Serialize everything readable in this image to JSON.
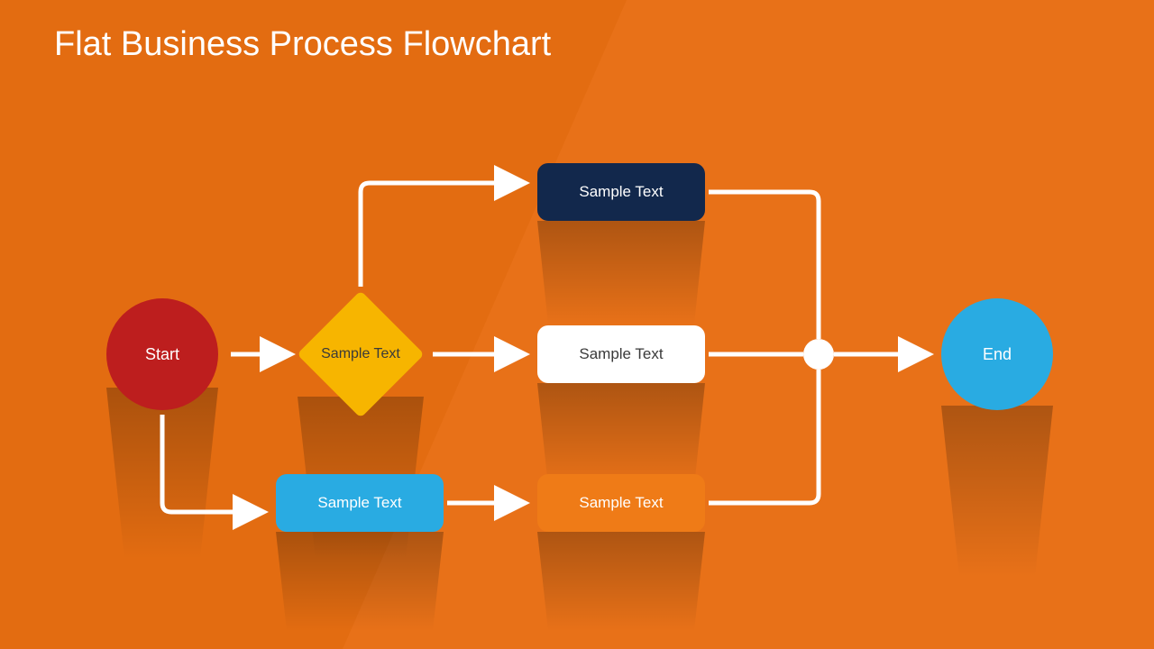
{
  "title": "Flat Business Process Flowchart",
  "nodes": {
    "start": "Start",
    "decision": "Sample Text",
    "top": "Sample Text",
    "mid": "Sample Text",
    "altProc": "Sample Text",
    "bottom": "Sample Text",
    "end": "End"
  },
  "colors": {
    "bg": "#E36C11",
    "start": "#BD1E1E",
    "decision": "#F7B500",
    "navy": "#12284C",
    "white": "#FFFFFF",
    "blue": "#29ABE2",
    "orange": "#EF7B17"
  }
}
